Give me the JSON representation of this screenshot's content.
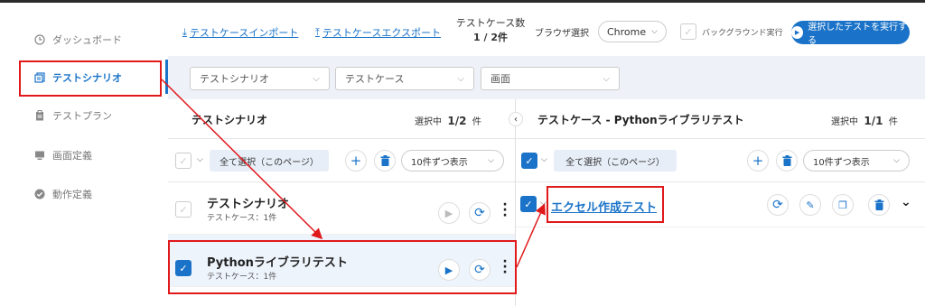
{
  "sidebar": {
    "items": [
      {
        "label": "ダッシュボード",
        "icon": "clock-icon"
      },
      {
        "label": "テストシナリオ",
        "icon": "document-stack-icon",
        "active": true
      },
      {
        "label": "テストプラン",
        "icon": "clipboard-icon"
      },
      {
        "label": "画面定義",
        "icon": "monitor-icon"
      },
      {
        "label": "動作定義",
        "icon": "check-circle-icon"
      }
    ]
  },
  "toolbar": {
    "import_label": "テストケースインポート",
    "export_label": "テストケースエクスポート",
    "count_label": "テストケース数",
    "count_value": "1 / 2件",
    "browser_label": "ブラウザ選択",
    "browser_value": "Chrome",
    "background_label": "バックグラウンド実行",
    "run_label": "選択したテストを実行する"
  },
  "filters": [
    {
      "placeholder": "テストシナリオ"
    },
    {
      "placeholder": "テストケース"
    },
    {
      "placeholder": "画面"
    }
  ],
  "left_panel": {
    "title": "テストシナリオ",
    "selected_prefix": "選択中",
    "selected_value": "1/2",
    "selected_suffix": "件",
    "select_all_label": "全て選択（このページ）",
    "per_page_label": "10件ずつ表示",
    "rows": [
      {
        "title": "テストシナリオ",
        "subtitle": "テストケース：1件",
        "checked": false
      },
      {
        "title": "Pythonライブラリテスト",
        "subtitle": "テストケース：1件",
        "checked": true
      }
    ]
  },
  "right_panel": {
    "title": "テストケース - Pythonライブラリテスト",
    "selected_prefix": "選択中",
    "selected_value": "1/1",
    "selected_suffix": "件",
    "select_all_label": "全て選択（このページ）",
    "per_page_label": "10件ずつ表示",
    "rows": [
      {
        "title": "エクセル作成テスト",
        "checked": true
      }
    ]
  },
  "colors": {
    "accent": "#1a73c8",
    "annotation": "#e0191b",
    "selected_row": "#eef4fc",
    "filter_bar": "#eef1f7"
  }
}
